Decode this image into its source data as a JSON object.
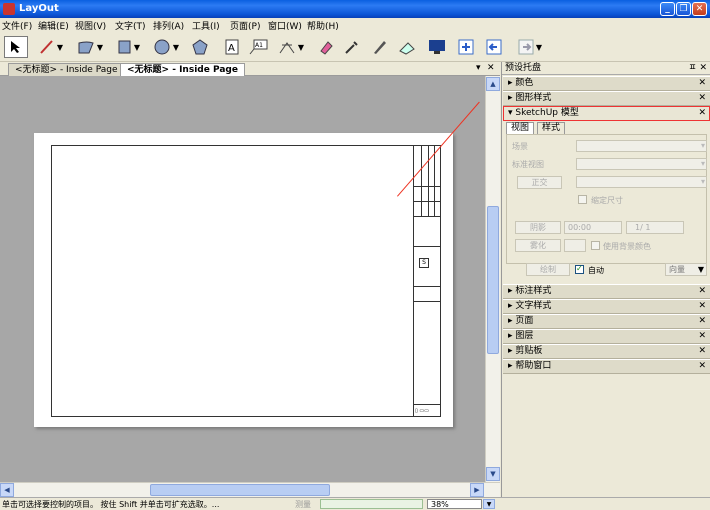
{
  "window": {
    "title": "LayOut"
  },
  "menu": [
    "文件(F)",
    "编辑(E)",
    "视图(V)",
    "文字(T)",
    "排列(A)",
    "工具(I)",
    "页面(P)",
    "窗口(W)",
    "帮助(H)"
  ],
  "doc_tabs": {
    "inactive": "<无标题> - Inside Page",
    "active": "<无标题> - Inside Page"
  },
  "tray": {
    "title": "预设托盘",
    "panels_top": [
      "颜色",
      "图形样式"
    ],
    "sketchup": {
      "title": "SketchUp 模型",
      "tabs": [
        "视图",
        "样式"
      ],
      "scene_label": "场景",
      "std_view_label": "标准视图",
      "ortho_button": "正交",
      "keep_scale": "缩定尺寸",
      "shadow_button": "阴影",
      "time_value": "00:00",
      "date_value": "1/ 1",
      "fog_button": "雾化",
      "bg_color_label": "使用背景颜色",
      "render_button": "绘制",
      "auto_label": "自动",
      "render_mode": "向量"
    },
    "panels_bottom": [
      "标注样式",
      "文字样式",
      "页面",
      "图层",
      "剪贴板",
      "帮助窗口"
    ]
  },
  "status": {
    "text": "单击可选择要控制的项目。 按住 Shift 并单击可扩充选取。...",
    "measure_label": "测量",
    "zoom": "38%"
  }
}
